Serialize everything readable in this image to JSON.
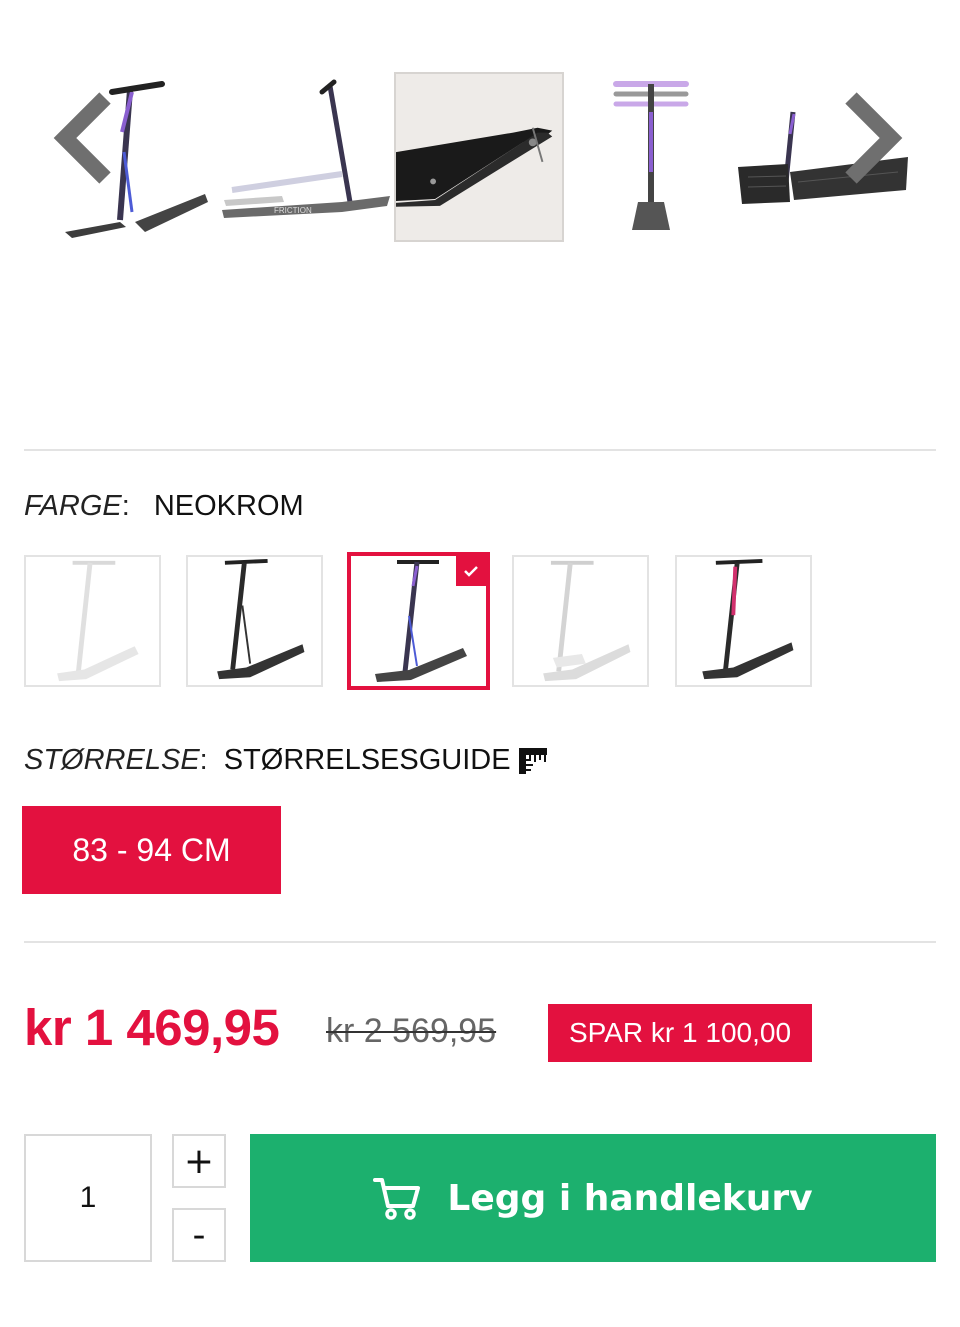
{
  "gallery": {
    "images": [
      {
        "icon": "scooter-side-image"
      },
      {
        "icon": "scooter-flat-image"
      },
      {
        "icon": "ski-closeup-image"
      },
      {
        "icon": "scooter-front-image"
      },
      {
        "icon": "scooter-skis-image"
      }
    ],
    "active_index": 2,
    "prev_icon": "chevron-left-icon",
    "next_icon": "chevron-right-icon"
  },
  "color": {
    "label": "FARGE",
    "colon": ":",
    "value": "NEOKROM",
    "swatches": [
      {
        "icon": "scooter-white-swatch"
      },
      {
        "icon": "scooter-black-swatch"
      },
      {
        "icon": "scooter-neochrome-swatch",
        "selected": true
      },
      {
        "icon": "scooter-silver-swatch"
      },
      {
        "icon": "scooter-pink-swatch"
      }
    ],
    "check_icon": "check-icon"
  },
  "size": {
    "label": "STØRRELSE",
    "colon": ":",
    "guide_label": "STØRRELSESGUIDE",
    "guide_icon": "ruler-icon",
    "selected_size": "83 - 94 CM"
  },
  "price": {
    "current": "kr 1 469,95",
    "original": "kr 2 569,95",
    "savings": "SPAR kr 1 100,00"
  },
  "purchase": {
    "quantity": "1",
    "plus_label": "+",
    "minus_label": "-",
    "cart_label": "Legg i handlekurv",
    "cart_icon": "shopping-cart-icon"
  },
  "colors": {
    "accent": "#e3113f",
    "cart_green": "#1cb06e",
    "divider": "#e3e3e3"
  }
}
